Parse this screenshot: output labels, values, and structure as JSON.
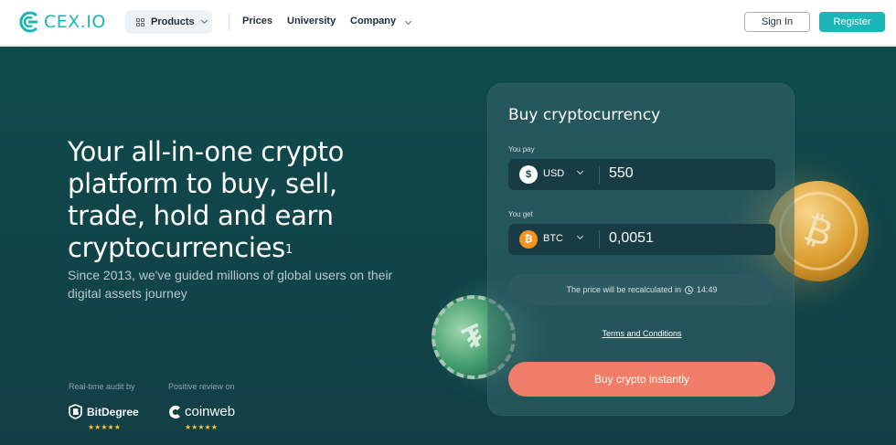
{
  "header": {
    "logo_text": "CEX.IO",
    "products_label": "Products",
    "nav": {
      "prices": "Prices",
      "university": "University",
      "company": "Company"
    },
    "sign_in": "Sign In",
    "register": "Register"
  },
  "hero": {
    "title": "Your all-in-one crypto platform to buy, sell, trade, hold and earn cryptocurrencies",
    "title_footnote": "1",
    "subtitle": "Since 2013, we've guided millions of global users on their digital assets journey",
    "audit_label": "Real-time audit by",
    "review_label": "Positive review on",
    "bitdegree_name": "BitDegree",
    "coinweb_name": "coinweb",
    "bitdegree_stars": "★★★★★",
    "coinweb_stars": "★★★★★"
  },
  "widget": {
    "title": "Buy cryptocurrency",
    "pay_label": "You pay",
    "pay_currency_symbol": "$",
    "pay_currency": "USD",
    "pay_amount": "550",
    "get_label": "You get",
    "get_currency_symbol": "₿",
    "get_currency": "BTC",
    "get_amount": "0,0051",
    "recalc_text": "The price will be recalculated in",
    "recalc_time": "14:49",
    "terms": "Terms and Conditions",
    "buy_button": "Buy crypto instantly"
  },
  "colors": {
    "brand": "#1cb5b8",
    "hero_bg": "#0f4a4c",
    "buy_button": "#ef7d67",
    "btc": "#f7931a"
  },
  "icons": [
    "cex-logo-icon",
    "products-grid-icon",
    "chevron-down-icon",
    "dollar-icon",
    "bitcoin-icon",
    "clock-icon",
    "bitdegree-logo-icon",
    "coinweb-logo-icon",
    "bitcoin-coin-image",
    "tether-coin-image"
  ]
}
